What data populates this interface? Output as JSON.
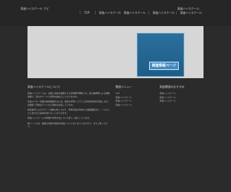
{
  "header": {
    "site_title": "東進ハイスクール ナビ",
    "top_right": "東進ハイスクール",
    "nav": [
      {
        "label": "TOP"
      },
      {
        "label": "東進ハイスクール"
      },
      {
        "label": "東進ハイスクール"
      },
      {
        "label": "東進ハイスクール"
      },
      {
        "label": "東進ハイスクール"
      }
    ]
  },
  "banner": {
    "label": "関連情報ページ"
  },
  "main": {
    "section_title": "東進ハイスクールについて",
    "paragraphs": [
      "東進ハイスクールは、全国に校舎を展開する大学受験予備校です。実力講師陣による映像授業で、自分のペースで学習を進めることができます。",
      "高速マスター基礎力養成講座をはじめ、独自の学習システムで志望校合格を目指します。全国統一高校生テストなど模試も充実しています。",
      "担任助手によるサポート体制も整っており、学習計画の作成から進路相談まで、一人ひとりに合わせた指導を受けることができます。",
      "東進ハイスクールの特徴や学習方法について詳しく紹介しています。",
      "各ページでは、講座の内容や模試の情報についてまとめていますので、ぜひご覧ください。"
    ]
  },
  "sidebar_mid": {
    "title": "関連メニュー",
    "items": [
      "TOP",
      "東進ハイスクール",
      "東進ハイスクール",
      "東進ハイスクール"
    ]
  },
  "sidebar_right": {
    "title": "東進関連のおすすめ",
    "items": [
      "東進ハイスクール",
      "東進ハイスクール",
      "東進ハイスクール"
    ]
  },
  "colors": {
    "background": "#2b2b2b",
    "hero": "#d6d6d6",
    "banner": "#2b6f9a"
  }
}
